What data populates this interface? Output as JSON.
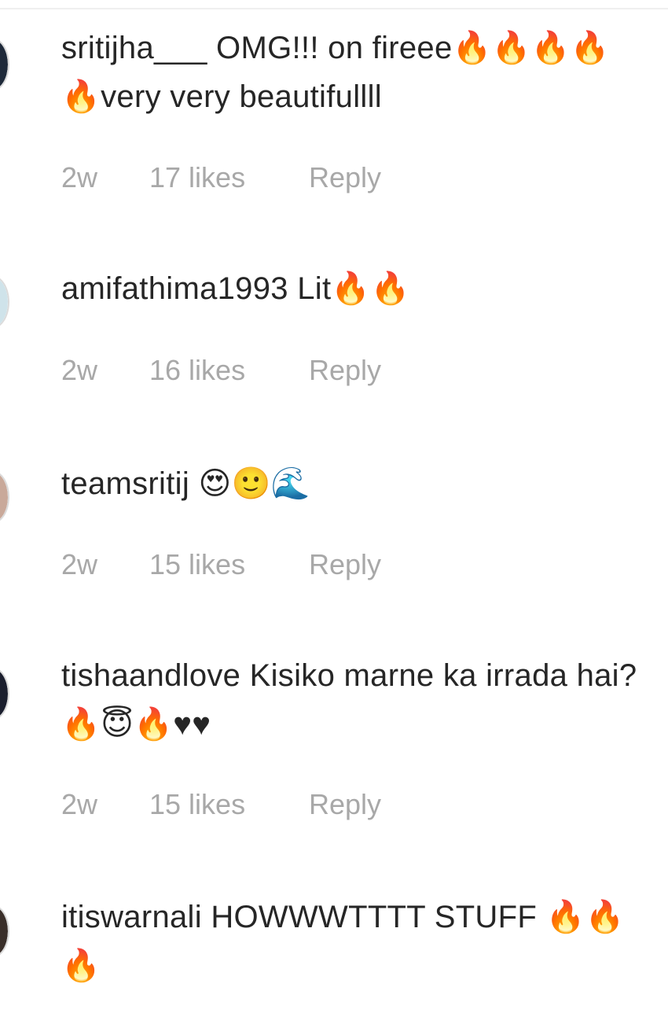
{
  "comments": [
    {
      "username": "sritijha___",
      "text": "OMG!!! on fireee🔥🔥🔥🔥🔥very very beautifullll",
      "time": "2w",
      "likes": "17 likes",
      "reply": "Reply",
      "avatar_color": "#1f2a3a"
    },
    {
      "username": "amifathima1993",
      "text": "Lit🔥🔥",
      "time": "2w",
      "likes": "16 likes",
      "reply": "Reply",
      "avatar_color": "#cfe3ea"
    },
    {
      "username": "teamsritij",
      "text": "😍🙂🌊",
      "time": "2w",
      "likes": "15 likes",
      "reply": "Reply",
      "avatar_color": "#c9a99a"
    },
    {
      "username": "tishaandlove",
      "text": "Kisiko marne ka irrada hai? 🔥😇🔥♥♥",
      "time": "2w",
      "likes": "15 likes",
      "reply": "Reply",
      "avatar_color": "#1b1f2e"
    },
    {
      "username": "itiswarnali",
      "text": "HOWWWTTTT STUFF 🔥🔥🔥",
      "avatar_color": "#3a2f2a"
    }
  ]
}
